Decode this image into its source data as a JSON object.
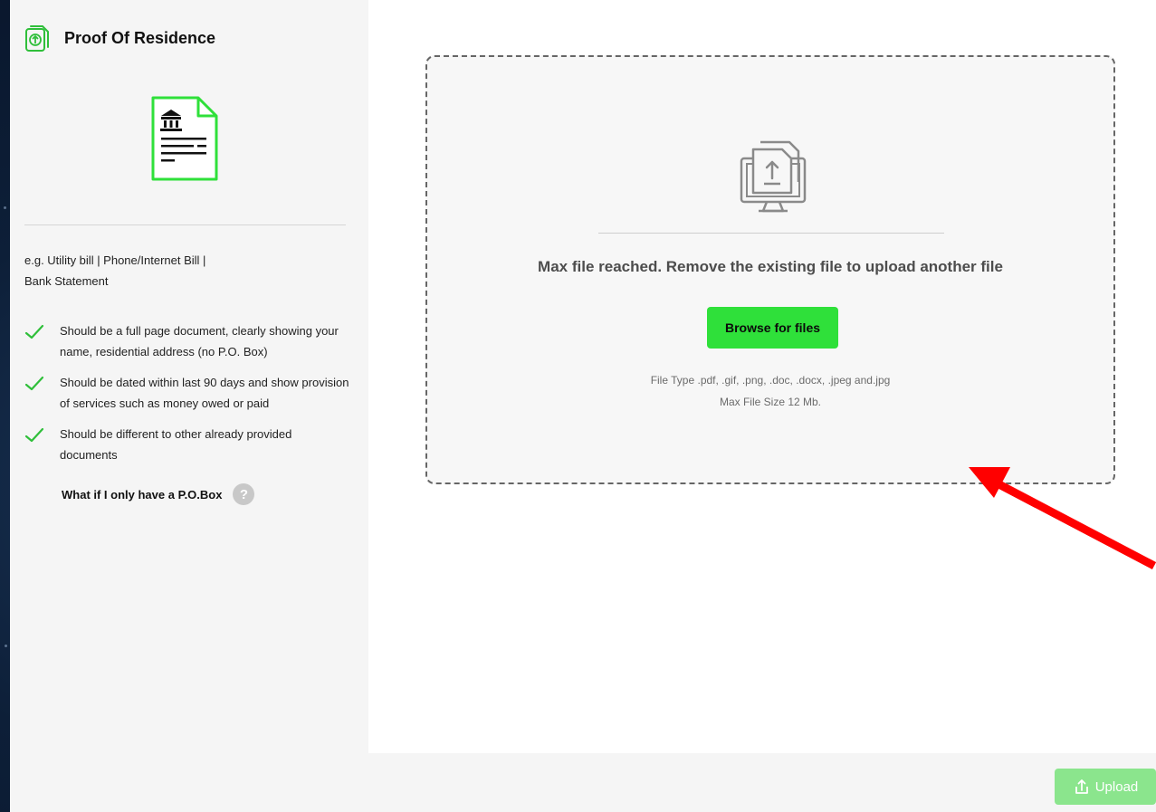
{
  "section": {
    "title": "Proof Of Residence",
    "examples_line1": "e.g. Utility bill | Phone/Internet Bill |",
    "examples_line2": "Bank Statement",
    "requirements": [
      "Should be a full page document, clearly showing your name, residential address (no P.O. Box)",
      "Should be dated within last 90 days and show provision of services such as money owed or paid",
      "Should be different to other already provided documents"
    ],
    "pobox_question": "What if I only have a P.O.Box",
    "help_glyph": "?"
  },
  "dropzone": {
    "message": "Max file reached. Remove the existing file to upload another file",
    "browse_label": "Browse for files",
    "file_types": "File Type .pdf, .gif, .png, .doc, .docx, .jpeg and.jpg",
    "max_size": "Max File Size 12 Mb."
  },
  "footer": {
    "upload_label": "Upload"
  },
  "colors": {
    "accent_green": "#2fe03a",
    "upload_disabled": "#8be58d",
    "annotation_arrow": "#ff0000"
  },
  "icons": {
    "header": "upload-document-icon",
    "illustration": "bank-document-icon",
    "dropzone": "monitor-upload-icon",
    "check": "check-icon",
    "help": "help-icon",
    "upload": "upload-icon"
  }
}
